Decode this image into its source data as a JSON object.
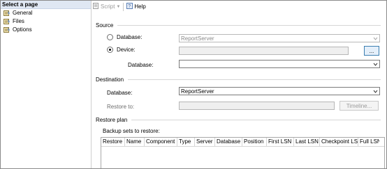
{
  "sidebar": {
    "title": "Select a page",
    "items": [
      {
        "label": "General",
        "icon": "page-icon"
      },
      {
        "label": "Files",
        "icon": "page-icon"
      },
      {
        "label": "Options",
        "icon": "page-icon"
      }
    ]
  },
  "toolbar": {
    "script_label": "Script",
    "help_label": "Help"
  },
  "source": {
    "section_label": "Source",
    "database_radio_label": "Database:",
    "database_value": "ReportServer",
    "device_radio_label": "Device:",
    "device_value": "",
    "browse_label": "...",
    "device_database_label": "Database:",
    "device_database_value": ""
  },
  "destination": {
    "section_label": "Destination",
    "database_label": "Database:",
    "database_value": "ReportServer",
    "restore_to_label": "Restore to:",
    "restore_to_value": "",
    "timeline_label": "Timeline..."
  },
  "restore_plan": {
    "section_label": "Restore plan",
    "backup_sets_label": "Backup sets to restore:",
    "columns": [
      "Restore",
      "Name",
      "Component",
      "Type",
      "Server",
      "Database",
      "Position",
      "First LSN",
      "Last LSN",
      "Checkpoint LSN",
      "Full LSN"
    ]
  },
  "colors": {
    "sidebar_header_bg": "#dfe7f3",
    "button_accent": "#3c7fb1"
  }
}
